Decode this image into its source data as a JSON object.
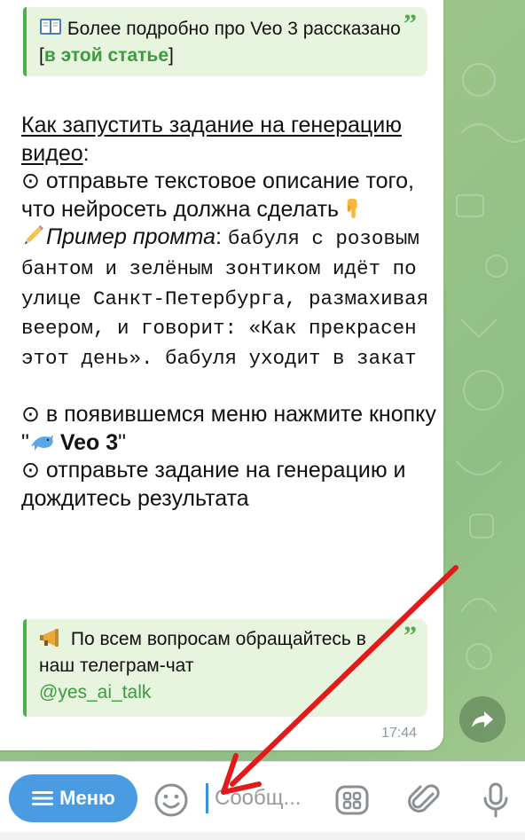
{
  "quote_top": {
    "icon": "open-book-icon",
    "text_before": "Более подробно про Veo 3 рассказано [",
    "link": "в этой статье",
    "text_after": "]",
    "quote_mark": "”"
  },
  "instructions": {
    "heading": "Как запустить задание на генерацию видео",
    "heading_suffix": ":",
    "step1": "⊙ отправьте текстовое описание того, что нейросеть должна сделать",
    "step1_emoji": "pointing-down-icon",
    "example_icon": "pencil-icon",
    "example_label": "Пример промта",
    "example_colon": ": ",
    "example_prompt": "бабуля с розовым бантом и зелёным зонтиком идёт по улице Санкт-Петербурга, размахивая веером, и говорит: «Как прекрасен этот день». бабуля уходит в закат",
    "step2_before": "⊙ в появившемся меню нажмите кнопку \"",
    "step2_icon": "dolphin-icon",
    "step2_button": " Veo 3",
    "step2_after": "\"",
    "step3": "⊙ отправьте задание на генерацию и дождитесь результата"
  },
  "quote_bottom": {
    "icon": "megaphone-icon",
    "text": "По всем вопросам обращайтесь в наш телеграм-чат",
    "handle": "@yes_ai_talk",
    "quote_mark": "”"
  },
  "message": {
    "time": "17:44"
  },
  "input_bar": {
    "menu_label": "Меню",
    "placeholder": "Сообщ...",
    "icons": [
      "menu-lines-icon",
      "emoji-smile-icon",
      "bot-commands-icon",
      "paperclip-icon",
      "microphone-icon"
    ]
  },
  "colors": {
    "accent_green": "#4fae4e",
    "menu_blue": "#4a9be2",
    "annotation_arrow": "#e01b1b"
  }
}
